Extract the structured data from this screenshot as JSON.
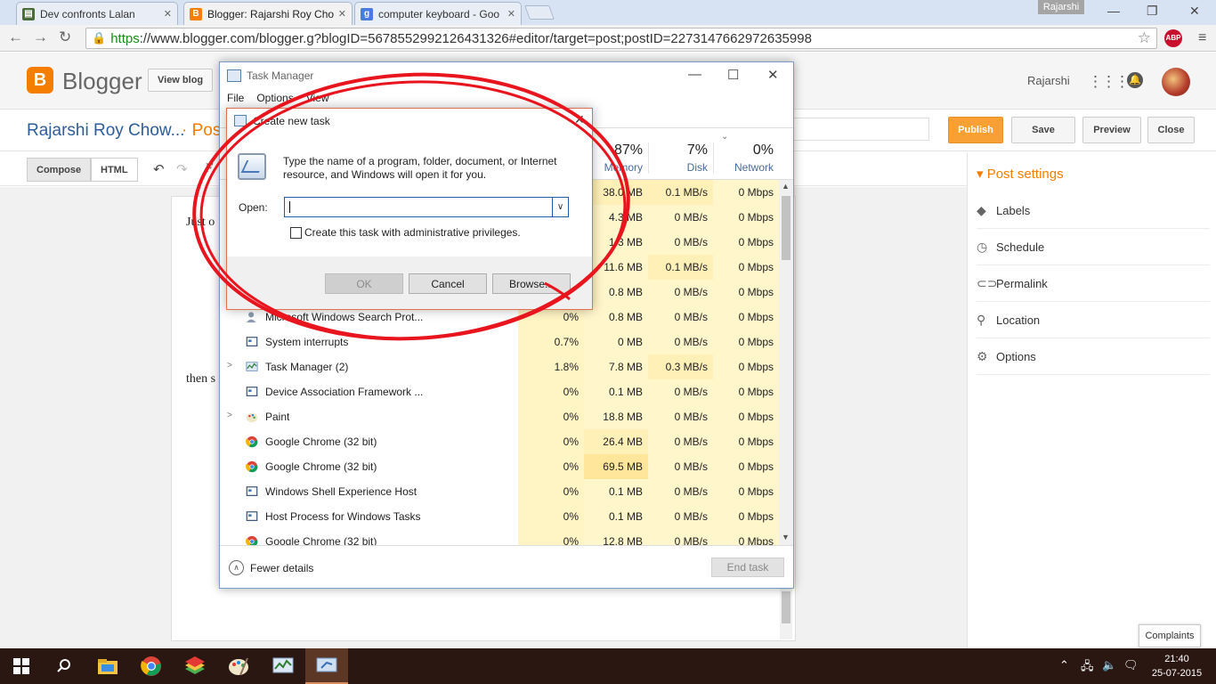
{
  "browser": {
    "tabs": [
      {
        "title": "Dev confronts Lalan",
        "icon": "page-icon",
        "active": false
      },
      {
        "title": "Blogger: Rajarshi Roy Cho",
        "icon": "blogger-icon",
        "active": true
      },
      {
        "title": "computer keyboard - Goo",
        "icon": "google-icon",
        "active": false
      }
    ],
    "profile_name": "Rajarshi",
    "url_scheme": "https",
    "url_rest": "://www.blogger.com/blogger.g?blogID=5678552992126431326#editor/target=post;postID=2273147662972635998",
    "abp_label": "ABP",
    "icons": {
      "back": "back-arrow-icon",
      "forward": "forward-arrow-icon",
      "reload": "reload-icon",
      "star": "star-icon",
      "menu": "menu-icon"
    }
  },
  "blogger": {
    "brand": "Blogger",
    "view_blog": "View blog",
    "user": "Rajarshi",
    "blog_title": "Rajarshi Roy Chow...",
    "post_label": "· Pos",
    "buttons": {
      "publish": "Publish",
      "save": "Save",
      "preview": "Preview",
      "close": "Close"
    },
    "modes": {
      "compose": "Compose",
      "html": "HTML"
    },
    "editor_text": {
      "line1": "Just o",
      "line2": "then s"
    },
    "colors": {
      "accent": "#f57d00",
      "link": "#2d5d9a"
    }
  },
  "sidebar": {
    "title": "Post settings",
    "items": [
      {
        "label": "Labels",
        "icon": "tag-icon"
      },
      {
        "label": "Schedule",
        "icon": "clock-icon"
      },
      {
        "label": "Permalink",
        "icon": "link-icon"
      },
      {
        "label": "Location",
        "icon": "pin-icon"
      },
      {
        "label": "Options",
        "icon": "gear-icon"
      }
    ]
  },
  "complaints": "Complaints",
  "taskmgr": {
    "title": "Task Manager",
    "menu": [
      "File",
      "Options",
      "View"
    ],
    "columns": {
      "memory": {
        "pct": "87%",
        "label": "Memory"
      },
      "disk": {
        "pct": "7%",
        "label": "Disk"
      },
      "network": {
        "pct": "0%",
        "label": "Network"
      }
    },
    "rows": [
      {
        "name": "",
        "cpu": "",
        "mem": "38.0 MB",
        "disk": "0.1 MB/s",
        "net": "0 Mbps"
      },
      {
        "name": "",
        "cpu": "",
        "mem": "4.3 MB",
        "disk": "0 MB/s",
        "net": "0 Mbps"
      },
      {
        "name": "",
        "cpu": "",
        "mem": "1.3 MB",
        "disk": "0 MB/s",
        "net": "0 Mbps"
      },
      {
        "name": "",
        "cpu": "",
        "mem": "11.6 MB",
        "disk": "0.1 MB/s",
        "net": "0 Mbps"
      },
      {
        "name": "",
        "cpu": "",
        "mem": "0.8 MB",
        "disk": "0 MB/s",
        "net": "0 Mbps"
      },
      {
        "name": "Microsoft Windows Search Prot...",
        "cpu": "0%",
        "mem": "0.8 MB",
        "disk": "0 MB/s",
        "net": "0 Mbps"
      },
      {
        "name": "System interrupts",
        "cpu": "0.7%",
        "mem": "0 MB",
        "disk": "0 MB/s",
        "net": "0 Mbps"
      },
      {
        "name": "Task Manager (2)",
        "cpu": "1.8%",
        "mem": "7.8 MB",
        "disk": "0.3 MB/s",
        "net": "0 Mbps"
      },
      {
        "name": "Device Association Framework ...",
        "cpu": "0%",
        "mem": "0.1 MB",
        "disk": "0 MB/s",
        "net": "0 Mbps"
      },
      {
        "name": "Paint",
        "cpu": "0%",
        "mem": "18.8 MB",
        "disk": "0 MB/s",
        "net": "0 Mbps"
      },
      {
        "name": "Google Chrome (32 bit)",
        "cpu": "0%",
        "mem": "26.4 MB",
        "disk": "0 MB/s",
        "net": "0 Mbps"
      },
      {
        "name": "Google Chrome (32 bit)",
        "cpu": "0%",
        "mem": "69.5 MB",
        "disk": "0 MB/s",
        "net": "0 Mbps"
      },
      {
        "name": "Windows Shell Experience Host",
        "cpu": "0%",
        "mem": "0.1 MB",
        "disk": "0 MB/s",
        "net": "0 Mbps"
      },
      {
        "name": "Host Process for Windows Tasks",
        "cpu": "0%",
        "mem": "0.1 MB",
        "disk": "0 MB/s",
        "net": "0 Mbps"
      },
      {
        "name": "Google Chrome (32 bit)",
        "cpu": "0%",
        "mem": "12.8 MB",
        "disk": "0 MB/s",
        "net": "0 Mbps"
      }
    ],
    "fewer_details": "Fewer details",
    "end_task": "End task"
  },
  "dialog": {
    "title": "Create new task",
    "description": "Type the name of a program, folder, document, or Internet resource, and Windows will open it for you.",
    "open_label": "Open:",
    "open_value": "",
    "admin_checkbox": "Create this task with administrative privileges.",
    "buttons": {
      "ok": "OK",
      "cancel": "Cancel",
      "browse": "Browse..."
    }
  },
  "taskbar": {
    "time": "21:40",
    "date": "25-07-2015",
    "apps": [
      "file-explorer-icon",
      "chrome-icon",
      "bluestacks-icon",
      "paint-icon",
      "task-manager-icon",
      "run-icon"
    ]
  }
}
